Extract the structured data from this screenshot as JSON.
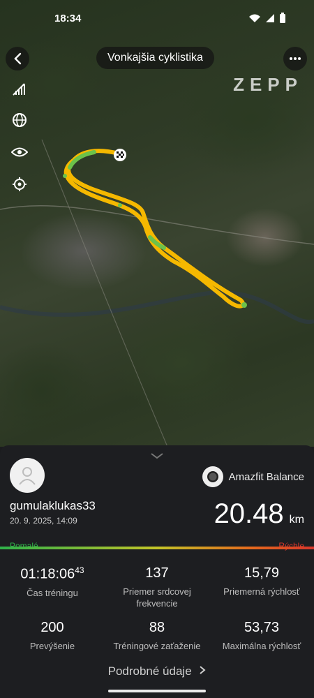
{
  "status": {
    "time": "18:34"
  },
  "header": {
    "title": "Vonkajšia cyklistika",
    "brand": "ZEPP"
  },
  "map_controls": [
    "signal-off-icon",
    "globe-icon",
    "eye-icon",
    "locate-icon"
  ],
  "summary": {
    "device": "Amazfit Balance",
    "username": "gumulaklukas33",
    "datetime": "20. 9. 2025, 14:09",
    "distance_value": "20.48",
    "distance_unit": "km",
    "speed_legend": {
      "slow": "Pomalé",
      "fast": "Rýchle"
    },
    "stats": [
      {
        "value": "01:18:06",
        "value_sup": "43",
        "label": "Čas tréningu"
      },
      {
        "value": "137",
        "label": "Priemer srdcovej frekvencie"
      },
      {
        "value": "15,79",
        "label": "Priemerná rýchlosť"
      },
      {
        "value": "200",
        "label": "Prevýšenie"
      },
      {
        "value": "88",
        "label": "Tréningové zaťaženie"
      },
      {
        "value": "53,73",
        "label": "Maximálna rýchlosť"
      }
    ],
    "details_link": "Podrobné údaje"
  },
  "colors": {
    "route": "#f5b800",
    "route_green": "#6cc24a",
    "slow": "#2fb24a",
    "fast": "#d6362b"
  }
}
